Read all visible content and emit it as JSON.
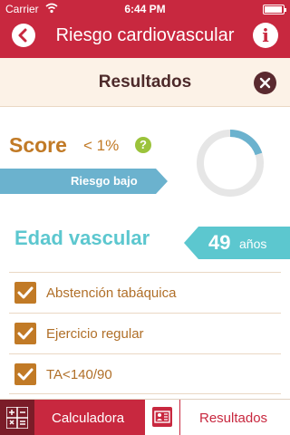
{
  "status_bar": {
    "carrier": "Carrier",
    "time": "6:44 PM"
  },
  "nav": {
    "title": "Riesgo cardiovascular",
    "back_icon": "chevron-left-icon",
    "info_icon": "info-icon",
    "info_glyph": "i"
  },
  "results": {
    "label": "Resultados",
    "close_icon": "close-icon"
  },
  "score": {
    "label": "Score",
    "value": "< 1%",
    "help_glyph": "?",
    "risk_label": "Riesgo bajo",
    "gauge_fraction": 0.2
  },
  "vascular_age": {
    "label": "Edad vascular",
    "value": "49",
    "unit": "años"
  },
  "checklist": [
    {
      "label": "Abstención tabáquica",
      "checked": true
    },
    {
      "label": "Ejercicio regular",
      "checked": true
    },
    {
      "label": "TA<140/90",
      "checked": true
    }
  ],
  "tabs": [
    {
      "label": "Calculadora",
      "icon": "calculator-icon",
      "active": true
    },
    {
      "label": "Resultados",
      "icon": "id-card-icon",
      "active": false
    }
  ],
  "colors": {
    "brand_red": "#c8283f",
    "dark_red": "#7a1c28",
    "header_bg": "#fcf2e7",
    "accent_orange": "#c17a26",
    "risk_blue": "#6bb2ce",
    "teal": "#5cc7cf",
    "green": "#9bc33b"
  }
}
